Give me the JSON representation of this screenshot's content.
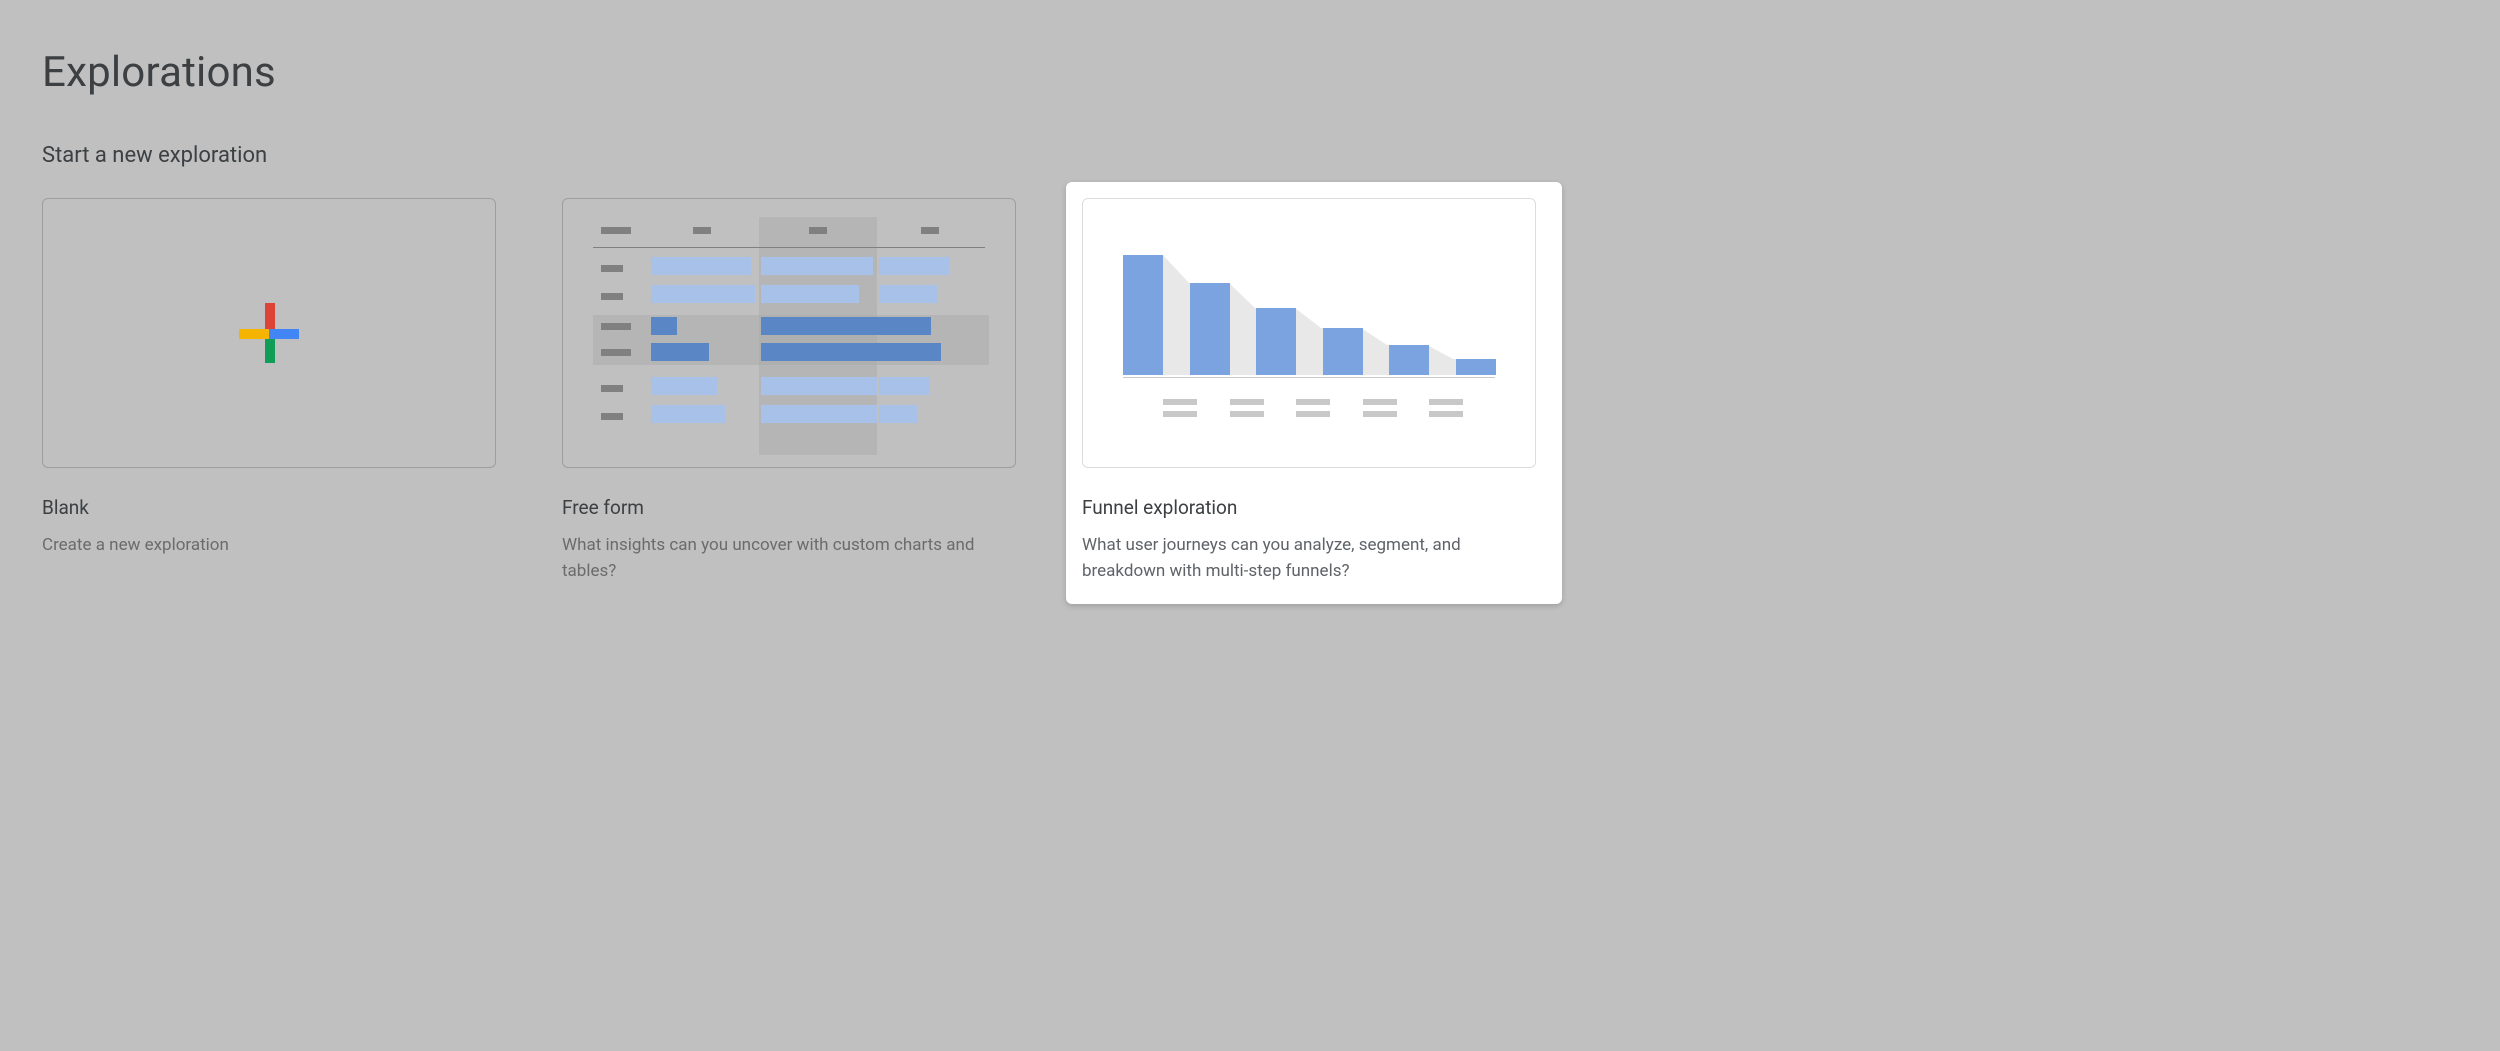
{
  "page_title": "Explorations",
  "section_title": "Start a new exploration",
  "cards": [
    {
      "title": "Blank",
      "desc": "Create a new exploration"
    },
    {
      "title": "Free form",
      "desc": "What insights can you uncover with custom charts and tables?"
    },
    {
      "title": "Funnel exploration",
      "desc": "What user journeys can you analyze, segment, and breakdown with multi-step funnels?"
    }
  ]
}
